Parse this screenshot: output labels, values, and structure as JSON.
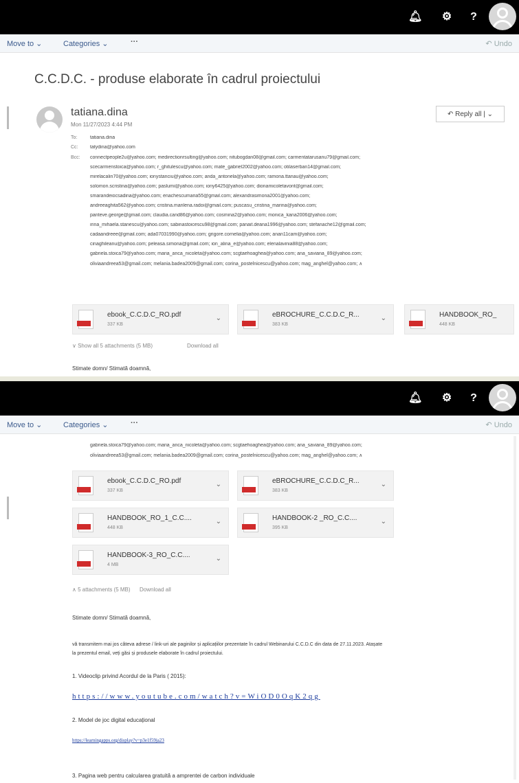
{
  "app": {
    "toolbar": {
      "move_to": "Move to ⌄",
      "categories": "Categories ⌄",
      "more": "···",
      "undo": "↶ Undo"
    }
  },
  "message": {
    "subject": "C.C.D.C. - produse elaborate în cadrul proiectului",
    "sender": "tatiana.dina",
    "date": "Mon 11/27/2023 4:44 PM",
    "reply_all": "↶ Reply all | ⌄",
    "to_label": "To:",
    "to": "tatiana.dina",
    "cc_label": "Cc:",
    "cc": "tatydina@yahoo.com",
    "bcc_label": "Bcc:",
    "bcc_lines": [
      "connectpeople2u@yahoo.com; medirectionrsulting@yahoo.com; nitubogdan08@gmail.com; carmentatarusanu79@gmail.com;",
      "scecarmenstoica@yahoo.com; r_ghitulescu@yahoo.com; mate_gabriel2002@yahoo.com; otilaserban14@gmail.com;",
      "mirelacalin70@yahoo.com; ionystanciu@yahoo.com; anda_antonela@yahoo.com; ramona.ttanau@yahoo.com;",
      "solomon.scristina@yahoo.com; paslumi@yahoo.com; iony6425@yahoo.com; dionamicoletavont@gmail.com;",
      "smarandeiocsadina@yahoo.com; enachescumaria55@gmail.com; alexandrasimona2001@yahoo.com;",
      "andreeaghita562@yahoo.com; cristina.marilena.radoi@gmail.com; puscasu_cristina_marina@yahoo.com;",
      "panteve.george@gmail.com; claudia.cand86@yahoo.com; cosmina2@yahoo.com; monica_kana2006@yahoo.com;",
      "irina_mihaela.stanescu@yahoo.com; sabinastoicescu98@gmail.com; panait.deana1996@yahoo.com; stefanache12@gmail.com;",
      "cadaandreee@gmail.com; ada07031990@yahoo.com; grigore.cornelia@yahoo.com; anan11cam@yahoo.com;",
      "cinaghileanu@yahoo.com; peleasa.simona@gmail.com; ion_alina_e@yahoo.com; elenalavinia88@yahoo.com;",
      "gabriela.stoica79@yahoo.com; maria_anca_nicoleta@yahoo.com; scgtaehoaghea@yahoo.com; ana_saviana_89@yahoo.com;",
      "oliviaandreea53@gmail.com; melania.badea2009@gmail.com; corina_postelnicescu@yahoo.com; mag_anghel@yahoo.com; ∧"
    ],
    "attachments": [
      {
        "name": "ebook_C.C.D.C_RO.pdf",
        "size": "337 KB"
      },
      {
        "name": "eBROCHURE_C.C.D.C_R...",
        "size": "383 KB"
      },
      {
        "name": "HANDBOOK_RO_1_C.C....",
        "size": "448 KB"
      },
      {
        "name": "HANDBOOK-2 _RO_C.C....",
        "size": "395 KB"
      },
      {
        "name": "HANDBOOK-3_RO_C.C....",
        "size": "4 MB"
      }
    ],
    "att3_truncated": "HANDBOOK_RO_",
    "show_all": "∨ Show all 5 attachments (5 MB)",
    "download_all": "Download all",
    "att_summary_2": "∧ 5 attachments (5 MB)",
    "greeting": "Stimate domn/ Stimată doamnă,",
    "para1_line1": "vă transmitem mai jos câteva adrese / link-uri ale paginilor și aplicațiilor prezentate în cadrul Webinarului C.C.D.C din data de 27.11.2023. Atașate",
    "para1_line2": "la prezentul email, veți găsi și produsele elaborate în cadrul proiectului.",
    "item1": "1. Videoclip privind Acordul de la Paris ( 2015):",
    "link1": "https://www.youtube.com/watch?v=WiOD0OqK2qg",
    "item2": "2. Model de joc digital educațional",
    "link2": "https://learningapps.org/display?v=p3e1f59ja23",
    "item3": "3. Pagina web pentru calcularea gratuită a amprentei de carbon individuale"
  }
}
